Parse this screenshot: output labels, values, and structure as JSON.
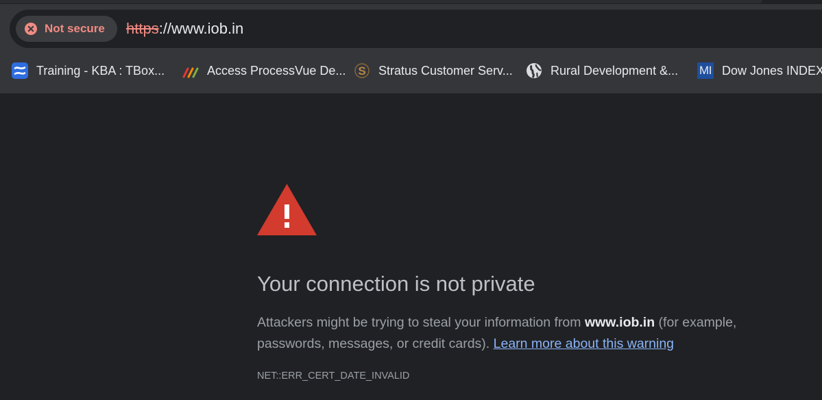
{
  "address_bar": {
    "security_label": "Not secure",
    "url_scheme": "https",
    "url_rest": "://www.iob.in"
  },
  "bookmarks": [
    {
      "label": "Training - KBA : TBox...",
      "icon": "confluence-icon"
    },
    {
      "label": "Access ProcessVue De...",
      "icon": "processvue-icon"
    },
    {
      "label": "Stratus Customer Serv...",
      "icon": "stratus-icon"
    },
    {
      "label": "Rural Development &...",
      "icon": "globe-icon"
    },
    {
      "label": "Dow Jones INDEX T",
      "icon": "mi-icon",
      "icon_text": "MI"
    }
  ],
  "interstitial": {
    "icon": "warning-icon",
    "heading": "Your connection is not private",
    "body_part1": "Attackers might be trying to steal your information from ",
    "site": "www.iob.in",
    "body_part2": " (for example, passwords, messages, or credit cards). ",
    "learn_more": "Learn more about this warning",
    "error_code": "NET::ERR_CERT_DATE_INVALID"
  },
  "colors": {
    "page_background": "#202124",
    "toolbar_background": "#35363a",
    "not_secure": "#f28b82",
    "warning_red": "#d33b2e",
    "link": "#8ab4f8"
  }
}
